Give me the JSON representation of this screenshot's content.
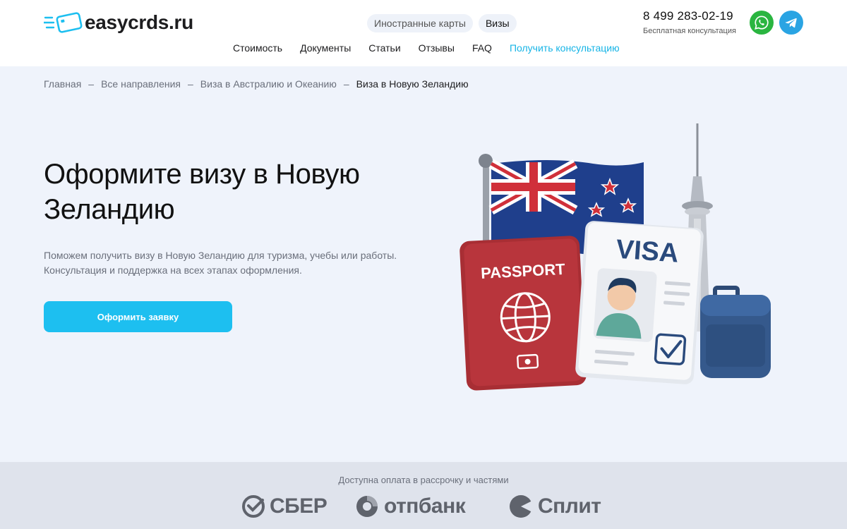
{
  "header": {
    "logo_text": "easycrds.ru",
    "top_tabs": [
      {
        "label": "Иностранные карты",
        "active": false
      },
      {
        "label": "Визы",
        "active": true
      }
    ],
    "phone": "8 499 283-02-19",
    "phone_note": "Бесплатная консультация",
    "social": [
      "whatsapp-icon",
      "telegram-icon"
    ],
    "nav": [
      {
        "label": "Стоимость"
      },
      {
        "label": "Документы"
      },
      {
        "label": "Статьи"
      },
      {
        "label": "Отзывы"
      },
      {
        "label": "FAQ"
      },
      {
        "label": "Получить консультацию",
        "accent": true
      }
    ]
  },
  "breadcrumb": {
    "items": [
      "Главная",
      "Все направления",
      "Виза в Австралию и Океанию"
    ],
    "current": "Виза в Новую Зеландию",
    "separator": "–"
  },
  "hero": {
    "title": "Оформите визу в Новую Зеландию",
    "text_line1": "Поможем получить визу в Новую Зеландию для туризма, учебы или работы.",
    "text_line2": "Консультация и поддержка на всех этапах оформления.",
    "cta_label": "Оформить заявку",
    "illustration": {
      "passport_label": "PASSPORT",
      "visa_label": "VISA"
    }
  },
  "payments": {
    "title": "Доступна оплата в рассрочку и частями",
    "logos": [
      {
        "name": "sber",
        "text": "СБЕР"
      },
      {
        "name": "otp",
        "text": "отпбанк"
      },
      {
        "name": "split",
        "text": "Сплит"
      }
    ]
  },
  "colors": {
    "accent": "#1dbff0",
    "link_accent": "#16b4e6",
    "whatsapp": "#2ab540",
    "telegram": "#2aa4e3",
    "page_bg": "#eff3fb",
    "footer_bg": "#dfe3ec"
  }
}
